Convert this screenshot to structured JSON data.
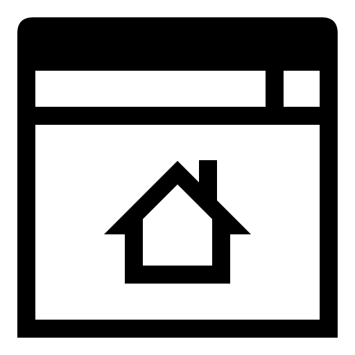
{
  "icon": {
    "name": "browser-home-icon",
    "foreground_color": "#000000",
    "background_color": "#ffffff",
    "parts": {
      "window": "browser-window-icon",
      "title_bar": "title-bar",
      "address_bar": "address-bar",
      "window_button": "window-button",
      "content": "content-area",
      "home": "home-icon"
    }
  }
}
